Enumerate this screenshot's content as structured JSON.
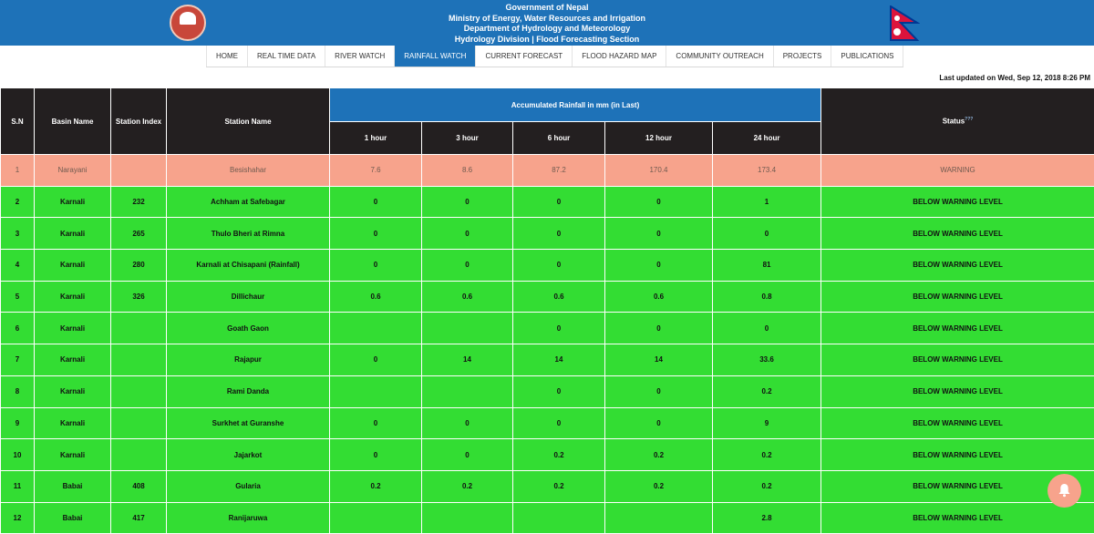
{
  "header": {
    "lines": [
      "Government of Nepal",
      "Ministry of Energy, Water Resources and Irrigation",
      "Department of Hydrology and Meteorology",
      "Hydrology Division | Flood Forecasting Section"
    ],
    "emblem_icon": "nepal-emblem-icon",
    "flag_icon": "nepal-flag-icon",
    "colors": {
      "bar": "#1e72b8",
      "flag_red": "#dc143c",
      "flag_blue": "#003893"
    }
  },
  "nav": {
    "items": [
      {
        "label": "HOME"
      },
      {
        "label": "REAL TIME DATA"
      },
      {
        "label": "RIVER WATCH"
      },
      {
        "label": "RAINFALL WATCH",
        "active": true
      },
      {
        "label": "CURRENT FORECAST"
      },
      {
        "label": "FLOOD HAZARD MAP"
      },
      {
        "label": "COMMUNITY OUTREACH"
      },
      {
        "label": "PROJECTS"
      },
      {
        "label": "PUBLICATIONS"
      }
    ]
  },
  "last_updated": "Last updated on Wed, Sep 12, 2018 8:26 PM",
  "table": {
    "headers": {
      "sn": "S.N",
      "basin": "Basin Name",
      "index": "Station Index",
      "station": "Station Name",
      "accumulated": "Accumulated Rainfall in mm (in Last)",
      "periods": [
        "1 hour",
        "3 hour",
        "6 hour",
        "12 hour",
        "24 hour"
      ],
      "status": "Status",
      "status_sup": "???"
    },
    "rows": [
      {
        "sn": "1",
        "basin": "Narayani",
        "index": "",
        "station": "Besishahar",
        "r1": "7.6",
        "r3": "8.6",
        "r6": "87.2",
        "r12": "170.4",
        "r24": "173.4",
        "status": "WARNING",
        "level": "warning"
      },
      {
        "sn": "2",
        "basin": "Karnali",
        "index": "232",
        "station": "Achham at Safebagar",
        "r1": "0",
        "r3": "0",
        "r6": "0",
        "r12": "0",
        "r24": "1",
        "status": "BELOW WARNING LEVEL",
        "level": "green"
      },
      {
        "sn": "3",
        "basin": "Karnali",
        "index": "265",
        "station": "Thulo Bheri at Rimna",
        "r1": "0",
        "r3": "0",
        "r6": "0",
        "r12": "0",
        "r24": "0",
        "status": "BELOW WARNING LEVEL",
        "level": "green"
      },
      {
        "sn": "4",
        "basin": "Karnali",
        "index": "280",
        "station": "Karnali at Chisapani (Rainfall)",
        "r1": "0",
        "r3": "0",
        "r6": "0",
        "r12": "0",
        "r24": "81",
        "status": "BELOW WARNING LEVEL",
        "level": "green"
      },
      {
        "sn": "5",
        "basin": "Karnali",
        "index": "326",
        "station": "Dillichaur",
        "r1": "0.6",
        "r3": "0.6",
        "r6": "0.6",
        "r12": "0.6",
        "r24": "0.8",
        "status": "BELOW WARNING LEVEL",
        "level": "green"
      },
      {
        "sn": "6",
        "basin": "Karnali",
        "index": "",
        "station": "Goath Gaon",
        "r1": "",
        "r3": "",
        "r6": "0",
        "r12": "0",
        "r24": "0",
        "status": "BELOW WARNING LEVEL",
        "level": "green"
      },
      {
        "sn": "7",
        "basin": "Karnali",
        "index": "",
        "station": "Rajapur",
        "r1": "0",
        "r3": "14",
        "r6": "14",
        "r12": "14",
        "r24": "33.6",
        "status": "BELOW WARNING LEVEL",
        "level": "green"
      },
      {
        "sn": "8",
        "basin": "Karnali",
        "index": "",
        "station": "Rami Danda",
        "r1": "",
        "r3": "",
        "r6": "0",
        "r12": "0",
        "r24": "0.2",
        "status": "BELOW WARNING LEVEL",
        "level": "green"
      },
      {
        "sn": "9",
        "basin": "Karnali",
        "index": "",
        "station": "Surkhet at Guranshe",
        "r1": "0",
        "r3": "0",
        "r6": "0",
        "r12": "0",
        "r24": "9",
        "status": "BELOW WARNING LEVEL",
        "level": "green"
      },
      {
        "sn": "10",
        "basin": "Karnali",
        "index": "",
        "station": "Jajarkot",
        "r1": "0",
        "r3": "0",
        "r6": "0.2",
        "r12": "0.2",
        "r24": "0.2",
        "status": "BELOW WARNING LEVEL",
        "level": "green"
      },
      {
        "sn": "11",
        "basin": "Babai",
        "index": "408",
        "station": "Gularia",
        "r1": "0.2",
        "r3": "0.2",
        "r6": "0.2",
        "r12": "0.2",
        "r24": "0.2",
        "status": "BELOW WARNING LEVEL",
        "level": "green"
      },
      {
        "sn": "12",
        "basin": "Babai",
        "index": "417",
        "station": "Ranijaruwa",
        "r1": "",
        "r3": "",
        "r6": "",
        "r12": "",
        "r24": "2.8",
        "status": "BELOW WARNING LEVEL",
        "level": "green"
      }
    ],
    "colors": {
      "header_dark": "#231f20",
      "header_accent": "#1e72b8",
      "warning": "#f7a38c",
      "below_warning": "#33dd33"
    }
  },
  "fab": {
    "icon": "bell-icon",
    "color": "#f7a38c"
  }
}
